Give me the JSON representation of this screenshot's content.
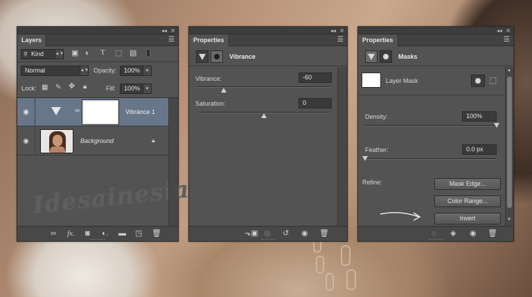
{
  "layers_panel": {
    "tab": "Layers",
    "filter_kind": "Kind",
    "blend_mode": "Normal",
    "opacity_label": "Opacity:",
    "opacity_value": "100%",
    "lock_label": "Lock:",
    "fill_label": "Fill:",
    "fill_value": "100%",
    "layers": [
      {
        "name": "Vibrance 1",
        "selected": true
      },
      {
        "name": "Background",
        "selected": false
      }
    ],
    "watermark": "Idesainesia"
  },
  "vibrance_panel": {
    "tab": "Properties",
    "header": "Vibrance",
    "vibrance_label": "Vibrance:",
    "vibrance_value": "-60",
    "vibrance_fraction": 0.2,
    "saturation_label": "Saturation:",
    "saturation_value": "0",
    "saturation_fraction": 0.5
  },
  "masks_panel": {
    "tab": "Properties",
    "header": "Masks",
    "layer_mask_label": "Layer Mask",
    "density_label": "Density:",
    "density_value": "100%",
    "density_fraction": 1.0,
    "feather_label": "Feather:",
    "feather_value": "0.0 px",
    "feather_fraction": 0.0,
    "refine_label": "Refine:",
    "mask_edge_button": "Mask Edge...",
    "color_range_button": "Color Range...",
    "invert_button": "Invert"
  },
  "window_controls": {
    "collapse": "◂◂",
    "close": "✕",
    "menu": "☰"
  }
}
